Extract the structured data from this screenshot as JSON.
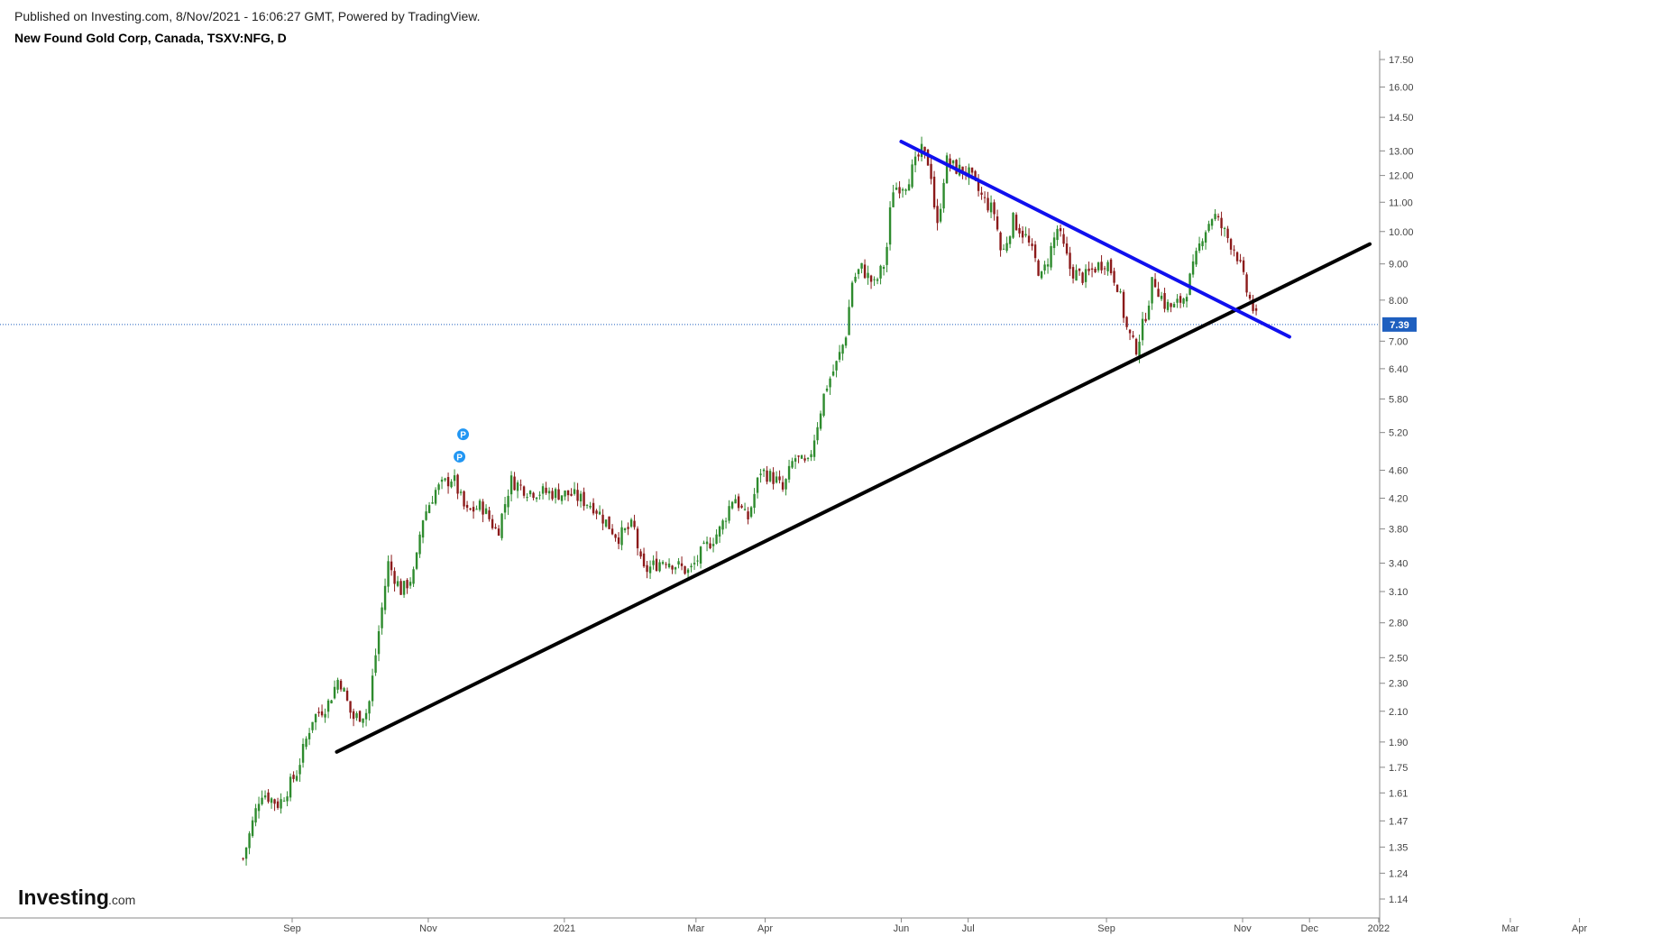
{
  "header": {
    "published": "Published on Investing.com, 8/Nov/2021 - 16:06:27 GMT, Powered by TradingView.",
    "title": "New Found Gold Corp, Canada, TSXV:NFG, D"
  },
  "branding": {
    "logo_text": "Investing",
    "logo_suffix": ".com"
  },
  "markers": [
    "P",
    "P"
  ],
  "colors": {
    "up": "#2e8b2e",
    "down": "#8b1a1a",
    "support_line": "#000000",
    "resistance_line": "#1010ee",
    "price_line": "#1e5fbf",
    "price_badge": "#1e5fbf",
    "marker": "#2196f3"
  },
  "chart_data": {
    "type": "candlestick",
    "title": "New Found Gold Corp, Canada, TSXV:NFG, D",
    "scale": "log",
    "ylim": [
      1.1,
      18.0
    ],
    "y_ticks": [
      17.5,
      16.0,
      14.5,
      13.0,
      12.0,
      11.0,
      10.0,
      9.0,
      8.0,
      7.0,
      6.4,
      5.8,
      5.2,
      4.6,
      4.2,
      3.8,
      3.4,
      3.1,
      2.8,
      2.5,
      2.3,
      2.1,
      1.9,
      1.75,
      1.61,
      1.47,
      1.35,
      1.24,
      1.14
    ],
    "y_tick_labels": [
      "17.50",
      "16.00",
      "14.50",
      "13.00",
      "12.00",
      "11.00",
      "10.00",
      "9.00",
      "8.00",
      "7.00",
      "6.40",
      "5.80",
      "5.20",
      "4.60",
      "4.20",
      "3.80",
      "3.40",
      "3.10",
      "2.80",
      "2.50",
      "2.30",
      "2.10",
      "1.90",
      "1.75",
      "1.61",
      "1.47",
      "1.35",
      "1.24",
      "1.14"
    ],
    "x_labels": [
      "Sep",
      "Nov",
      "2021",
      "Mar",
      "Apr",
      "Jun",
      "Jul",
      "Sep",
      "Nov",
      "Dec",
      "2022",
      "Mar",
      "Apr"
    ],
    "x_label_dates": [
      "2020-09-01",
      "2020-11-01",
      "2021-01-01",
      "2021-03-01",
      "2021-04-01",
      "2021-06-01",
      "2021-07-01",
      "2021-09-01",
      "2021-11-01",
      "2021-12-01",
      "2022-01-01",
      "2022-03-01",
      "2022-04-01"
    ],
    "last_price": 7.39,
    "last_price_label": "7.39",
    "close_path": [
      [
        "2020-08-10",
        1.3
      ],
      [
        "2020-08-18",
        1.62
      ],
      [
        "2020-08-26",
        1.55
      ],
      [
        "2020-09-03",
        1.72
      ],
      [
        "2020-09-10",
        2.05
      ],
      [
        "2020-09-17",
        2.15
      ],
      [
        "2020-09-22",
        2.35
      ],
      [
        "2020-09-28",
        2.05
      ],
      [
        "2020-10-05",
        2.1
      ],
      [
        "2020-10-10",
        2.75
      ],
      [
        "2020-10-14",
        3.4
      ],
      [
        "2020-10-20",
        3.1
      ],
      [
        "2020-10-26",
        3.3
      ],
      [
        "2020-10-29",
        3.9
      ],
      [
        "2020-11-04",
        4.3
      ],
      [
        "2020-11-12",
        4.5
      ],
      [
        "2020-11-18",
        4.0
      ],
      [
        "2020-11-25",
        4.1
      ],
      [
        "2020-12-02",
        3.75
      ],
      [
        "2020-12-08",
        4.45
      ],
      [
        "2020-12-16",
        4.3
      ],
      [
        "2021-01-04",
        4.25
      ],
      [
        "2021-01-14",
        4.1
      ],
      [
        "2021-01-25",
        3.7
      ],
      [
        "2021-02-01",
        3.85
      ],
      [
        "2021-02-05",
        3.3
      ],
      [
        "2021-02-15",
        3.45
      ],
      [
        "2021-02-26",
        3.3
      ],
      [
        "2021-03-03",
        3.5
      ],
      [
        "2021-03-12",
        3.8
      ],
      [
        "2021-03-18",
        4.25
      ],
      [
        "2021-03-24",
        3.9
      ],
      [
        "2021-03-30",
        4.6
      ],
      [
        "2021-04-06",
        4.45
      ],
      [
        "2021-04-09",
        4.3
      ],
      [
        "2021-04-14",
        4.8
      ],
      [
        "2021-04-20",
        4.65
      ],
      [
        "2021-04-28",
        6.0
      ],
      [
        "2021-05-03",
        6.5
      ],
      [
        "2021-05-07",
        7.1
      ],
      [
        "2021-05-10",
        8.5
      ],
      [
        "2021-05-14",
        8.9
      ],
      [
        "2021-05-20",
        8.4
      ],
      [
        "2021-05-25",
        9.1
      ],
      [
        "2021-05-28",
        11.5
      ],
      [
        "2021-06-03",
        11.7
      ],
      [
        "2021-06-07",
        12.4
      ],
      [
        "2021-06-10",
        13.0
      ],
      [
        "2021-06-14",
        12.4
      ],
      [
        "2021-06-17",
        10.0
      ],
      [
        "2021-06-21",
        12.6
      ],
      [
        "2021-06-25",
        12.3
      ],
      [
        "2021-07-01",
        12.1
      ],
      [
        "2021-07-07",
        11.2
      ],
      [
        "2021-07-13",
        10.6
      ],
      [
        "2021-07-16",
        9.2
      ],
      [
        "2021-07-21",
        10.4
      ],
      [
        "2021-07-27",
        9.8
      ],
      [
        "2021-08-03",
        8.6
      ],
      [
        "2021-08-10",
        10.1
      ],
      [
        "2021-08-16",
        8.8
      ],
      [
        "2021-08-22",
        8.6
      ],
      [
        "2021-08-27",
        8.9
      ],
      [
        "2021-09-01",
        9.1
      ],
      [
        "2021-09-06",
        8.4
      ],
      [
        "2021-09-10",
        7.3
      ],
      [
        "2021-09-14",
        6.8
      ],
      [
        "2021-09-18",
        7.5
      ],
      [
        "2021-09-22",
        8.6
      ],
      [
        "2021-09-27",
        7.9
      ],
      [
        "2021-10-01",
        7.8
      ],
      [
        "2021-10-06",
        8.1
      ],
      [
        "2021-10-10",
        8.9
      ],
      [
        "2021-10-14",
        9.9
      ],
      [
        "2021-10-19",
        10.6
      ],
      [
        "2021-10-22",
        10.2
      ],
      [
        "2021-10-27",
        9.6
      ],
      [
        "2021-10-29",
        9.4
      ],
      [
        "2021-11-03",
        8.2
      ],
      [
        "2021-11-05",
        7.9
      ],
      [
        "2021-11-08",
        7.39
      ]
    ],
    "annotations": {
      "support_trendline": {
        "points": [
          [
            "2020-09-21",
            1.84
          ],
          [
            "2021-12-28",
            9.6
          ]
        ],
        "color": "#000000"
      },
      "resistance_trendline": {
        "points": [
          [
            "2021-06-01",
            13.4
          ],
          [
            "2021-11-22",
            7.1
          ]
        ],
        "color": "#1010ee"
      }
    }
  }
}
